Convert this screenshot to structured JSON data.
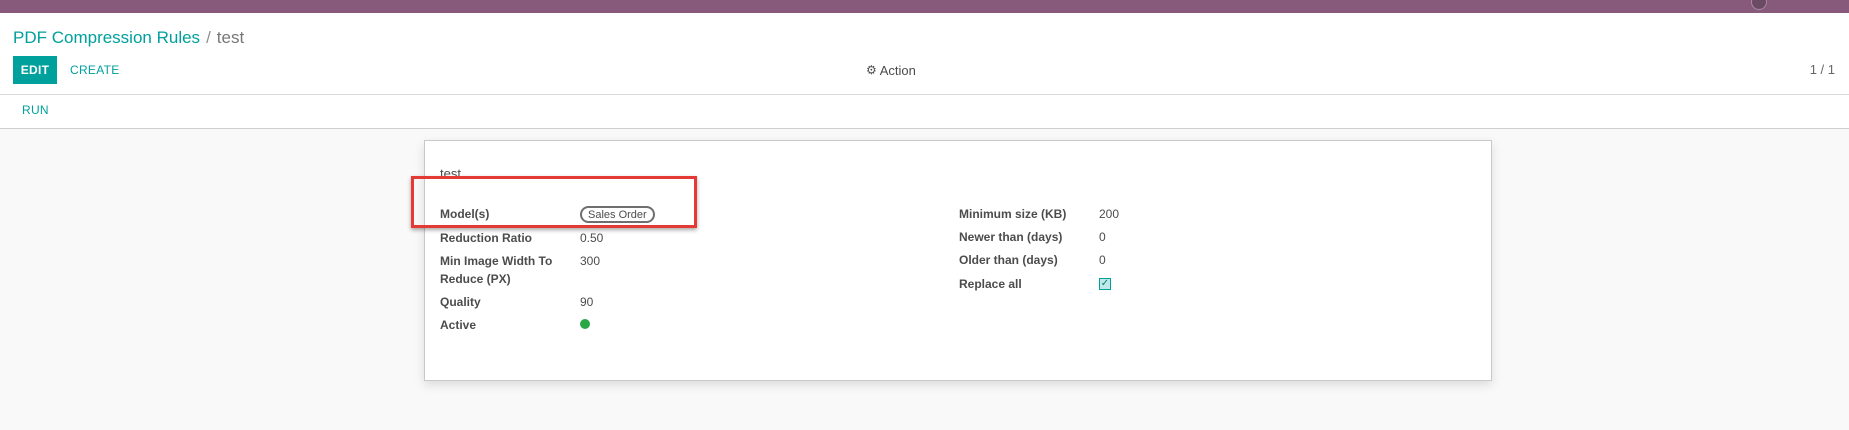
{
  "breadcrumb": {
    "parent": "PDF Compression Rules",
    "separator": "/",
    "current": "test"
  },
  "toolbar": {
    "edit_label": "EDIT",
    "create_label": "CREATE",
    "action_label": "Action",
    "pager": "1 / 1"
  },
  "statusbar": {
    "run_label": "RUN"
  },
  "record": {
    "name": "test",
    "left_fields": [
      {
        "label": "Model(s)",
        "value": "Sales Order"
      },
      {
        "label": "Reduction Ratio",
        "value": "0.50"
      },
      {
        "label": "Min Image Width To Reduce (PX)",
        "value": "300"
      },
      {
        "label": "Quality",
        "value": "90"
      },
      {
        "label": "Active",
        "value": true
      }
    ],
    "right_fields": [
      {
        "label": "Minimum size (KB)",
        "value": "200"
      },
      {
        "label": "Newer than (days)",
        "value": "0"
      },
      {
        "label": "Older than (days)",
        "value": "0"
      },
      {
        "label": "Replace all",
        "value": true
      }
    ]
  },
  "icons": {
    "action": "gear-icon",
    "replace_all": "checkbox-checked-icon",
    "active": "active-status-dot-icon"
  },
  "colors": {
    "topbar": "#875a7b",
    "primary": "#00a09d",
    "active_dot": "#28a745",
    "highlight": "#e53935"
  }
}
